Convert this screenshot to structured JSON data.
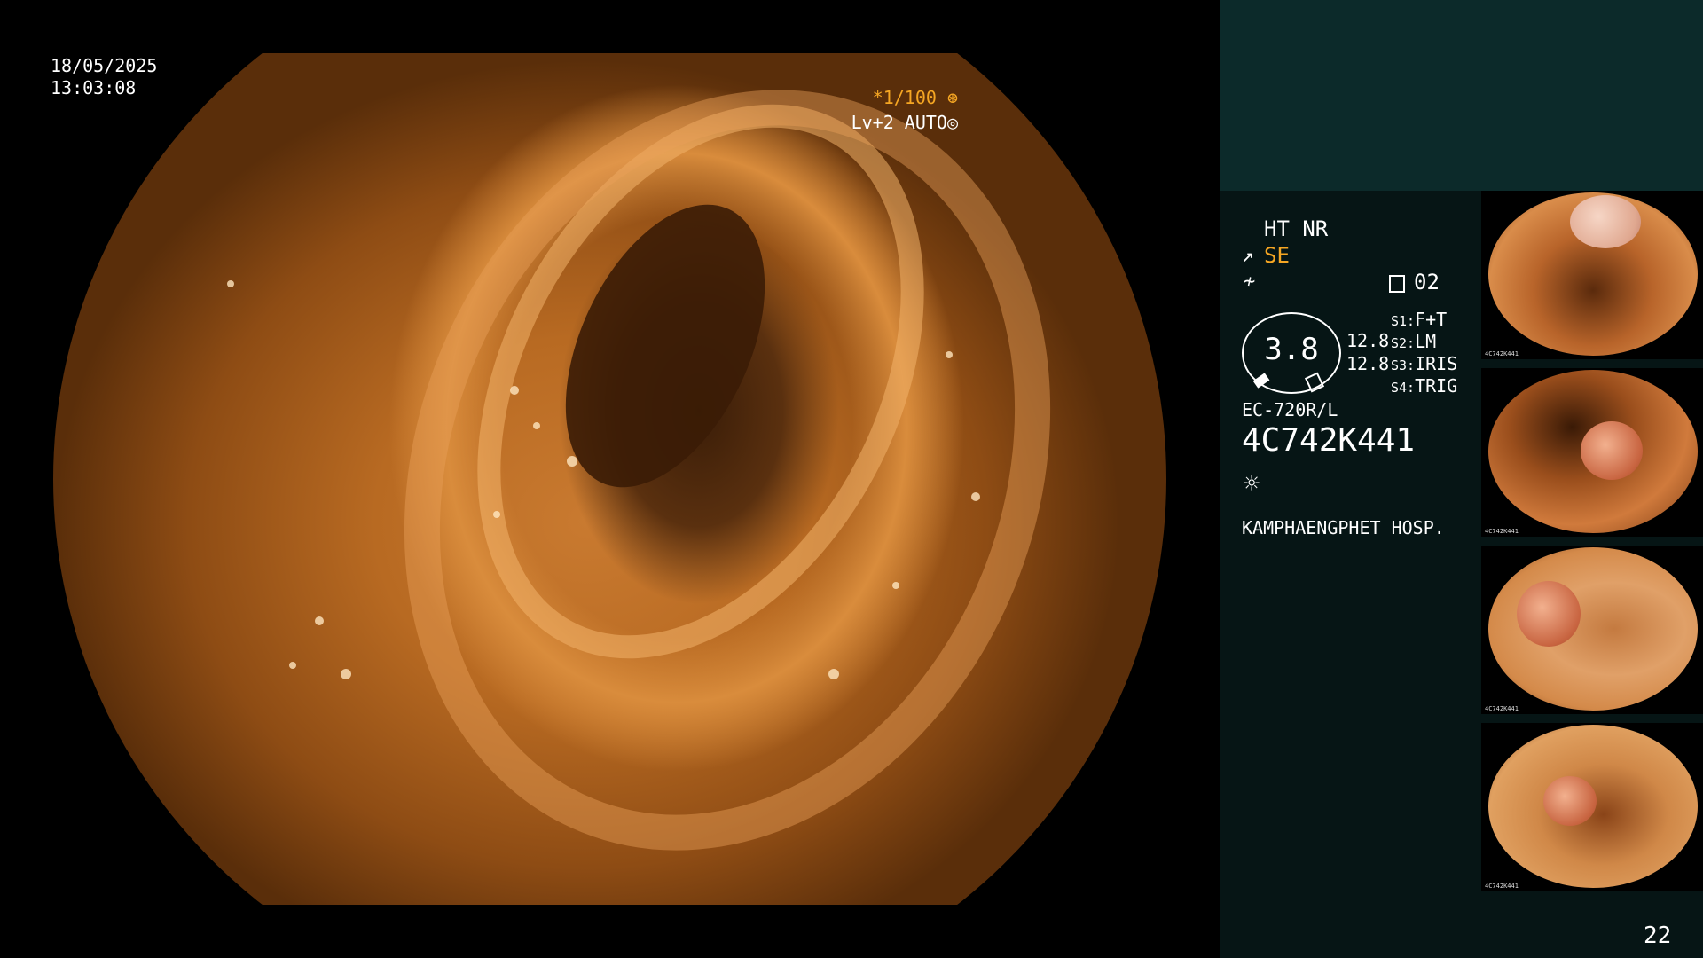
{
  "overlay": {
    "date": "18/05/2025",
    "time": "13:03:08",
    "shutter": "*1/100",
    "level": "Lv+2 AUTO"
  },
  "panel": {
    "mode": "HT NR",
    "enhance": "SE",
    "clip_number": "02",
    "gauge_value": "3.8",
    "value_1": "12.8",
    "value_2": "12.8",
    "switches": [
      {
        "key": "S1:",
        "value": "F+T"
      },
      {
        "key": "S2:",
        "value": "LM"
      },
      {
        "key": "S3:",
        "value": "IRIS"
      },
      {
        "key": "S4:",
        "value": "TRIG"
      }
    ],
    "scope_model": "EC-720R/L",
    "serial": "4C742K441",
    "hospital": "KAMPHAENGPHET HOSP.",
    "page_number": "22"
  },
  "icons": [
    "aperture-icon",
    "auto-iris-icon",
    "se-icon",
    "freeze-icon",
    "clip-icon",
    "lamp-icon"
  ],
  "thumbnails": [
    {
      "caption": "4C742K441"
    },
    {
      "caption": "4C742K441"
    },
    {
      "caption": "4C742K441"
    },
    {
      "caption": "4C742K441"
    }
  ],
  "colors": {
    "accent": "#f5a623",
    "panel_top": "#0c2a2a",
    "panel": "#061515"
  }
}
